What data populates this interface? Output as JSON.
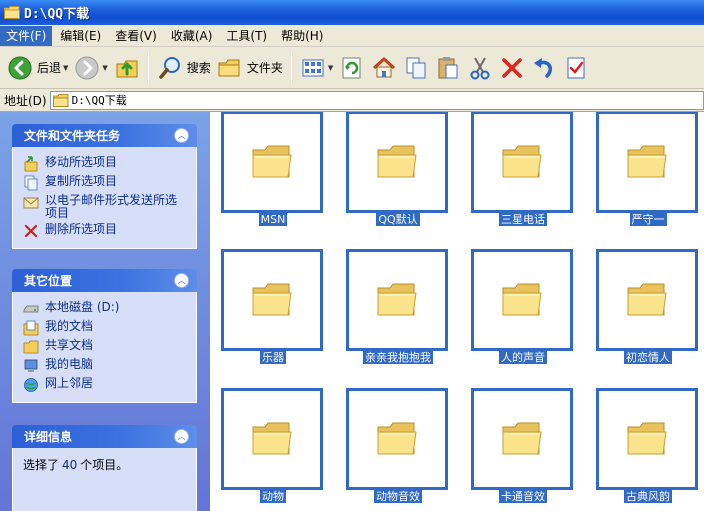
{
  "window": {
    "title": "D:\\QQ下载"
  },
  "menu": [
    {
      "label": "文件(F)",
      "active": true
    },
    {
      "label": "编辑(E)"
    },
    {
      "label": "查看(V)"
    },
    {
      "label": "收藏(A)"
    },
    {
      "label": "工具(T)"
    },
    {
      "label": "帮助(H)"
    }
  ],
  "toolbar": {
    "back_label": "后退",
    "search_label": "搜索",
    "folders_label": "文件夹",
    "icons": [
      "back-icon",
      "forward-icon",
      "up-folder-icon",
      "search-icon",
      "folders-icon",
      "views-icon",
      "refresh-icon",
      "home-icon",
      "copy-icon",
      "paste-icon",
      "cut-icon",
      "delete-icon",
      "undo-icon",
      "properties-icon"
    ]
  },
  "address": {
    "label": "地址(D)",
    "path": "D:\\QQ下载"
  },
  "tasks_panel": {
    "title": "文件和文件夹任务",
    "items": [
      "移动所选项目",
      "复制所选项目",
      "以电子邮件形式发送所选项目",
      "删除所选项目"
    ]
  },
  "places_panel": {
    "title": "其它位置",
    "items": [
      "本地磁盘 (D:)",
      "我的文档",
      "共享文档",
      "我的电脑",
      "网上邻居"
    ]
  },
  "details_panel": {
    "title": "详细信息",
    "text_before": "选择了 ",
    "count": "40",
    "text_after": " 个项目。"
  },
  "folders": [
    "MSN",
    "QQ默认",
    "三星电话",
    "严守一",
    "乐器",
    "亲亲我抱抱我",
    "人的声音",
    "初恋情人",
    "动物",
    "动物音效",
    "卡通音效",
    "古典风韵"
  ],
  "colors": {
    "selection": "#316ac5",
    "titlebar": "#0f4fd0",
    "taskpane": "#6375d6"
  }
}
